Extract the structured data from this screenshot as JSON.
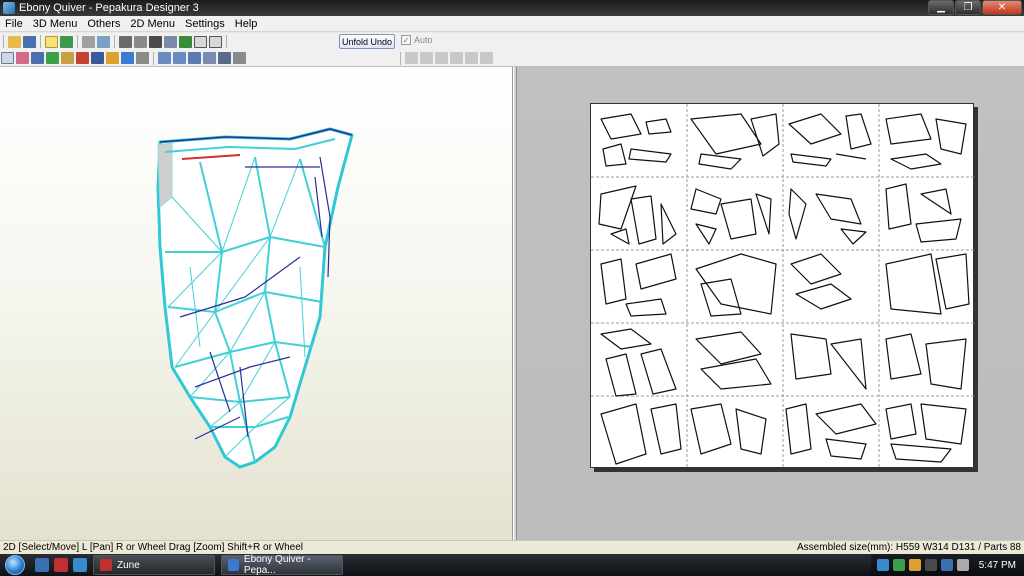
{
  "window": {
    "title": "Ebony Quiver - Pepakura Designer 3"
  },
  "menu": [
    "File",
    "3D Menu",
    "Others",
    "2D Menu",
    "Settings",
    "Help"
  ],
  "toolbar": {
    "unfold_undo": "Unfold Undo",
    "auto_label": "Auto"
  },
  "status": {
    "left": "2D [Select/Move] L [Pan] R or Wheel Drag [Zoom] Shift+R or Wheel",
    "right": "Assembled size(mm): H559 W314 D131 / Parts 88"
  },
  "taskbar": {
    "tasks": [
      "Zune",
      "Ebony Quiver - Pepa..."
    ],
    "clock": "5:47 PM"
  },
  "colors": {
    "mesh": "#40d0d8",
    "edge": "#2a2f9a",
    "accent_red": "#d03030"
  }
}
